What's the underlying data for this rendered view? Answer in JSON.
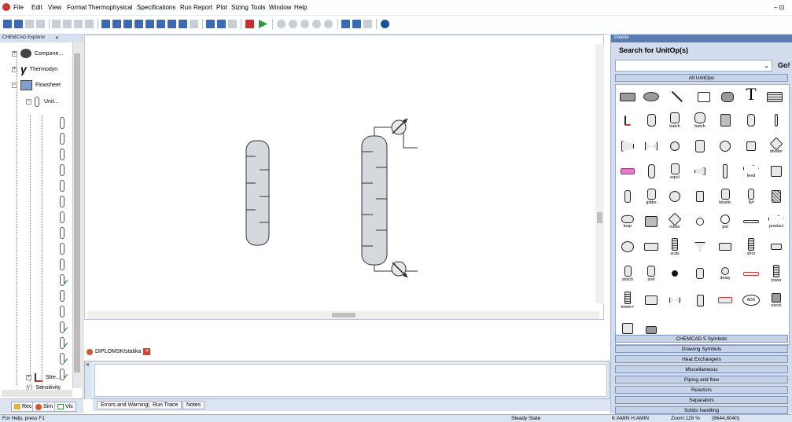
{
  "menubar": {
    "items": [
      "File",
      "Edit",
      "View",
      "Format",
      "Thermophysical",
      "Specifications",
      "Run",
      "Report",
      "Plot",
      "Sizing",
      "Tools",
      "Window",
      "Help"
    ],
    "window_controls": "– ⊡"
  },
  "explorer": {
    "title": "CHEMCAD Explorer",
    "items": {
      "components": "Compone...",
      "thermo": "Thermodyn",
      "flowsheet": "Flowsheet",
      "unit": "Unit...",
      "streams": "Stre...",
      "sensitivity": "Sensitivity"
    },
    "tabs": [
      "Rec",
      "Sim",
      "Vis"
    ]
  },
  "document": {
    "tab": "DIPLOMSKIstatika"
  },
  "output": {
    "tabs": [
      "Errors and Warnings",
      "Run Trace",
      "Notes"
    ]
  },
  "palette": {
    "title": "Palette",
    "search_label": "Search for UnitOp(s)",
    "go_label": "Go!",
    "all_label": "All UnitOps",
    "unit_labels": [
      "batch",
      "divider",
      "equil",
      "feed",
      "gibbs",
      "kinetic",
      "llvf",
      "loop",
      "mixer",
      "pid",
      "product",
      "scds",
      "shor",
      "stoich",
      "sref",
      "delay",
      "tower",
      "tower+",
      "excel",
      "ADD"
    ],
    "categories": [
      "CHEMCAD 5 Symbols",
      "Drawing Symbols",
      "Heat Exchangers",
      "Miscellaneous",
      "Piping and flow",
      "Reactors",
      "Separators",
      "Solids handling"
    ]
  },
  "status": {
    "help": "For Help, press F1",
    "state": "Steady State",
    "user": "K:AMIN H:AMIN",
    "zoom": "Zoom:128 %",
    "coords": "(8644,8040)"
  }
}
